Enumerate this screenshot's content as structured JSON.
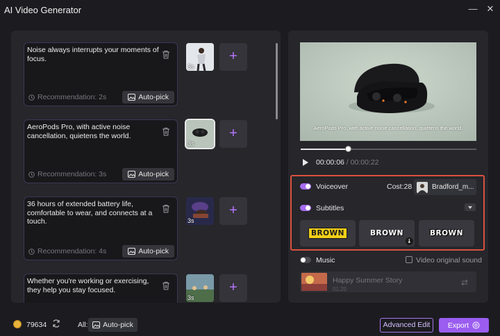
{
  "window": {
    "title": "AI Video Generator"
  },
  "segments": [
    {
      "text": "Noise always interrupts your moments of focus.",
      "recommendation": "Recommendation: 2s",
      "autopick": "Auto-pick",
      "clip_duration": "3s"
    },
    {
      "text": "AeroPods Pro, with active noise cancellation, quietens the world.",
      "recommendation": "Recommendation: 3s",
      "autopick": "Auto-pick",
      "clip_duration": "3s"
    },
    {
      "text": "36 hours of extended battery life, comfortable to wear, and connects at a touch.",
      "recommendation": "Recommendation: 4s",
      "autopick": "Auto-pick",
      "clip_duration": "3s"
    },
    {
      "text": "Whether you're working or exercising, they help you stay focused.",
      "clip_duration": "3s"
    }
  ],
  "add_symbol": "+",
  "preview": {
    "caption": "AeroPods Pro, with active noise cancellation, quietens the world.",
    "current_time": "00:00:06",
    "separator": "/",
    "total_time": "00:00:22",
    "progress": 0.27
  },
  "voiceover": {
    "label": "Voiceover",
    "enabled": true,
    "cost": "Cost:28",
    "voice_name": "Bradford_m..."
  },
  "subtitles": {
    "label": "Subtitles",
    "enabled": true,
    "styles": [
      "BROWN",
      "BROWN",
      "BROWN"
    ]
  },
  "music": {
    "label": "Music",
    "enabled": false,
    "video_original_sound": "Video original sound",
    "song": "Happy Summer Story",
    "duration": "01:20"
  },
  "footer": {
    "credits": "79634",
    "all_label": "All:",
    "all_autopick": "Auto-pick",
    "advanced_edit": "Advanced Edit",
    "export": "Export"
  },
  "colors": {
    "accent": "#9b5df0",
    "highlight_box": "#d9523f",
    "subtitle_yellow": "#f2cf18"
  }
}
